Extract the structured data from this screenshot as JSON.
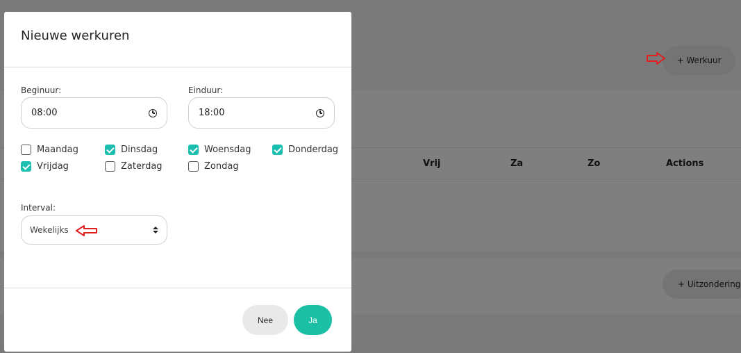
{
  "background": {
    "add_workhour_label": "+ Werkuur",
    "add_exception_label": "+ Uitzonderings",
    "table_headers": [
      "Vrij",
      "Za",
      "Zo",
      "Actions"
    ]
  },
  "modal": {
    "title": "Nieuwe werkuren",
    "start": {
      "label": "Beginuur:",
      "value": "08:00"
    },
    "end": {
      "label": "Einduur:",
      "value": "18:00"
    },
    "days": [
      {
        "label": "Maandag",
        "checked": false
      },
      {
        "label": "Dinsdag",
        "checked": true
      },
      {
        "label": "Woensdag",
        "checked": true
      },
      {
        "label": "Donderdag",
        "checked": true
      },
      {
        "label": "Vrijdag",
        "checked": true
      },
      {
        "label": "Zaterdag",
        "checked": false
      },
      {
        "label": "Zondag",
        "checked": false
      }
    ],
    "interval": {
      "label": "Interval:",
      "value": "Wekelijks"
    },
    "no_label": "Nee",
    "yes_label": "Ja"
  },
  "colors": {
    "accent": "#1bbfa3",
    "annotation_arrow": "#e02020"
  }
}
